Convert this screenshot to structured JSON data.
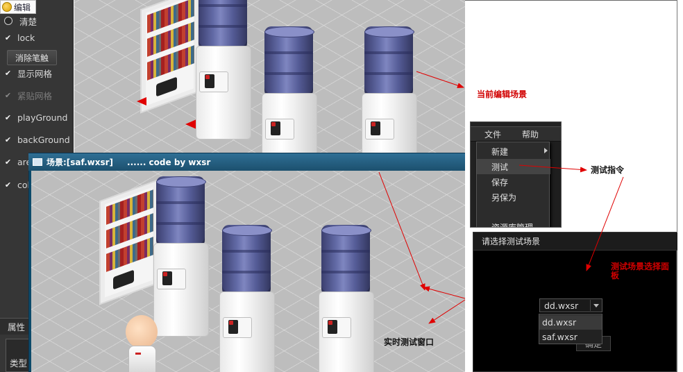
{
  "edit_tag": {
    "label": "编辑"
  },
  "left_panel": {
    "options": [
      {
        "type": "radio",
        "label": "清楚",
        "checked": false,
        "dim": false
      },
      {
        "type": "checkbox",
        "label": "lock",
        "checked": true,
        "dim": false
      },
      {
        "type": "button",
        "label": "消除笔触"
      },
      {
        "type": "checkbox",
        "label": "显示网格",
        "checked": true,
        "dim": false
      },
      {
        "type": "checkbox",
        "label": "紧贴网格",
        "checked": true,
        "dim": true
      },
      {
        "type": "checkbox",
        "label": "playGround",
        "checked": true,
        "dim": false
      },
      {
        "type": "checkbox",
        "label": "backGround",
        "checked": true,
        "dim": false
      },
      {
        "type": "checkbox",
        "label": "are",
        "checked": true,
        "dim": false
      },
      {
        "type": "checkbox",
        "label": "col",
        "checked": true,
        "dim": false
      }
    ],
    "properties_tab": "属性",
    "type_label": "类型"
  },
  "test_window": {
    "title": "场景:[saf.wxsr]",
    "credit": "...... code by wxsr"
  },
  "annotations": {
    "current_scene": "当前编辑场景",
    "test_command": "测试指令",
    "scene_panel": "测试场景选择面板",
    "realtime_window": "实时测试窗口"
  },
  "menu": {
    "bar": [
      "文件",
      "帮助"
    ],
    "items": [
      {
        "label": "新建",
        "submenu": true,
        "highlighted": false
      },
      {
        "label": "测试",
        "submenu": false,
        "highlighted": true
      },
      {
        "label": "保存",
        "submenu": false,
        "highlighted": false
      },
      {
        "label": "另保为",
        "submenu": false,
        "highlighted": false
      },
      {
        "label": "资源库管理",
        "submenu": false,
        "highlighted": false
      }
    ]
  },
  "scene_dialog": {
    "title": "请选择测试场景",
    "selected": "dd.wxsr",
    "options": [
      {
        "label": "dd.wxsr",
        "highlighted": true
      },
      {
        "label": "saf.wxsr",
        "highlighted": false
      }
    ],
    "ok_label": "确定"
  },
  "colors": {
    "annotation": "#d10000",
    "arrow": "#e00000",
    "scene_floor": "#bdbdbd"
  }
}
